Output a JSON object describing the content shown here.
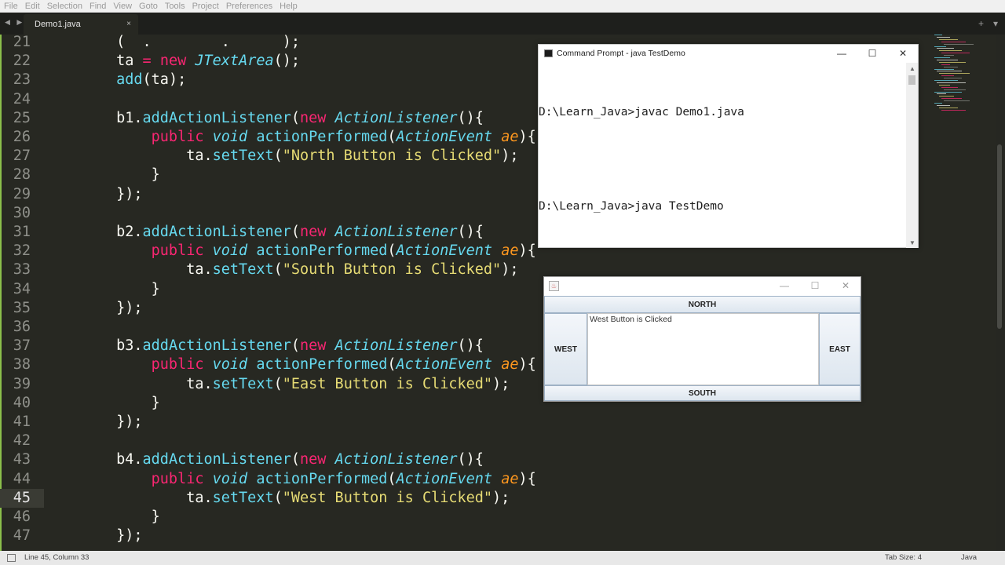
{
  "menu": [
    "File",
    "Edit",
    "Selection",
    "Find",
    "View",
    "Goto",
    "Tools",
    "Project",
    "Preferences",
    "Help"
  ],
  "tabs": [
    {
      "label": "Demo1.java",
      "close": "×"
    }
  ],
  "nav_arrows": "◀ ▶",
  "tabbar_right": {
    "add": "+",
    "more": "▾"
  },
  "editor": {
    "current_line": 45,
    "lines": [
      {
        "n": 21,
        "tokens": [
          [
            "t-plain",
            "        (  .        .      );"
          ]
        ]
      },
      {
        "n": 22,
        "tokens": [
          [
            "t-plain",
            "        ta "
          ],
          [
            "t-kw",
            "="
          ],
          [
            "t-plain",
            " "
          ],
          [
            "t-kw",
            "new"
          ],
          [
            "t-plain",
            " "
          ],
          [
            "t-type",
            "JTextArea"
          ],
          [
            "t-plain",
            "();"
          ]
        ]
      },
      {
        "n": 23,
        "tokens": [
          [
            "t-plain",
            "        "
          ],
          [
            "t-fn",
            "add"
          ],
          [
            "t-plain",
            "(ta);"
          ]
        ]
      },
      {
        "n": 24,
        "tokens": []
      },
      {
        "n": 25,
        "tokens": [
          [
            "t-plain",
            "        b1."
          ],
          [
            "t-fn",
            "addActionListener"
          ],
          [
            "t-plain",
            "("
          ],
          [
            "t-kw",
            "new"
          ],
          [
            "t-plain",
            " "
          ],
          [
            "t-type",
            "ActionListener"
          ],
          [
            "t-plain",
            "(){"
          ]
        ]
      },
      {
        "n": 26,
        "tokens": [
          [
            "t-plain",
            "            "
          ],
          [
            "t-kw",
            "public"
          ],
          [
            "t-plain",
            " "
          ],
          [
            "t-type",
            "void"
          ],
          [
            "t-plain",
            " "
          ],
          [
            "t-fn",
            "actionPerformed"
          ],
          [
            "t-plain",
            "("
          ],
          [
            "t-type",
            "ActionEvent"
          ],
          [
            "t-plain",
            " "
          ],
          [
            "t-param",
            "ae"
          ],
          [
            "t-plain",
            "){"
          ]
        ]
      },
      {
        "n": 27,
        "tokens": [
          [
            "t-plain",
            "                ta."
          ],
          [
            "t-fn",
            "setText"
          ],
          [
            "t-plain",
            "("
          ],
          [
            "t-str",
            "\"North Button is Clicked\""
          ],
          [
            "t-plain",
            ");"
          ]
        ]
      },
      {
        "n": 28,
        "tokens": [
          [
            "t-plain",
            "            }"
          ]
        ]
      },
      {
        "n": 29,
        "tokens": [
          [
            "t-plain",
            "        });"
          ]
        ]
      },
      {
        "n": 30,
        "tokens": []
      },
      {
        "n": 31,
        "tokens": [
          [
            "t-plain",
            "        b2."
          ],
          [
            "t-fn",
            "addActionListener"
          ],
          [
            "t-plain",
            "("
          ],
          [
            "t-kw",
            "new"
          ],
          [
            "t-plain",
            " "
          ],
          [
            "t-type",
            "ActionListener"
          ],
          [
            "t-plain",
            "(){"
          ]
        ]
      },
      {
        "n": 32,
        "tokens": [
          [
            "t-plain",
            "            "
          ],
          [
            "t-kw",
            "public"
          ],
          [
            "t-plain",
            " "
          ],
          [
            "t-type",
            "void"
          ],
          [
            "t-plain",
            " "
          ],
          [
            "t-fn",
            "actionPerformed"
          ],
          [
            "t-plain",
            "("
          ],
          [
            "t-type",
            "ActionEvent"
          ],
          [
            "t-plain",
            " "
          ],
          [
            "t-param",
            "ae"
          ],
          [
            "t-plain",
            "){"
          ]
        ]
      },
      {
        "n": 33,
        "tokens": [
          [
            "t-plain",
            "                ta."
          ],
          [
            "t-fn",
            "setText"
          ],
          [
            "t-plain",
            "("
          ],
          [
            "t-str",
            "\"South Button is Clicked\""
          ],
          [
            "t-plain",
            ");"
          ]
        ]
      },
      {
        "n": 34,
        "tokens": [
          [
            "t-plain",
            "            }"
          ]
        ]
      },
      {
        "n": 35,
        "tokens": [
          [
            "t-plain",
            "        });"
          ]
        ]
      },
      {
        "n": 36,
        "tokens": []
      },
      {
        "n": 37,
        "tokens": [
          [
            "t-plain",
            "        b3."
          ],
          [
            "t-fn",
            "addActionListener"
          ],
          [
            "t-plain",
            "("
          ],
          [
            "t-kw",
            "new"
          ],
          [
            "t-plain",
            " "
          ],
          [
            "t-type",
            "ActionListener"
          ],
          [
            "t-plain",
            "(){"
          ]
        ]
      },
      {
        "n": 38,
        "tokens": [
          [
            "t-plain",
            "            "
          ],
          [
            "t-kw",
            "public"
          ],
          [
            "t-plain",
            " "
          ],
          [
            "t-type",
            "void"
          ],
          [
            "t-plain",
            " "
          ],
          [
            "t-fn",
            "actionPerformed"
          ],
          [
            "t-plain",
            "("
          ],
          [
            "t-type",
            "ActionEvent"
          ],
          [
            "t-plain",
            " "
          ],
          [
            "t-param",
            "ae"
          ],
          [
            "t-plain",
            "){"
          ]
        ]
      },
      {
        "n": 39,
        "tokens": [
          [
            "t-plain",
            "                ta."
          ],
          [
            "t-fn",
            "setText"
          ],
          [
            "t-plain",
            "("
          ],
          [
            "t-str",
            "\"East Button is Clicked\""
          ],
          [
            "t-plain",
            ");"
          ]
        ]
      },
      {
        "n": 40,
        "tokens": [
          [
            "t-plain",
            "            }"
          ]
        ]
      },
      {
        "n": 41,
        "tokens": [
          [
            "t-plain",
            "        });"
          ]
        ]
      },
      {
        "n": 42,
        "tokens": []
      },
      {
        "n": 43,
        "tokens": [
          [
            "t-plain",
            "        b4."
          ],
          [
            "t-fn",
            "addActionListener"
          ],
          [
            "t-plain",
            "("
          ],
          [
            "t-kw",
            "new"
          ],
          [
            "t-plain",
            " "
          ],
          [
            "t-type",
            "ActionListener"
          ],
          [
            "t-plain",
            "(){"
          ]
        ]
      },
      {
        "n": 44,
        "tokens": [
          [
            "t-plain",
            "            "
          ],
          [
            "t-kw",
            "public"
          ],
          [
            "t-plain",
            " "
          ],
          [
            "t-type",
            "void"
          ],
          [
            "t-plain",
            " "
          ],
          [
            "t-fn",
            "actionPerformed"
          ],
          [
            "t-plain",
            "("
          ],
          [
            "t-type",
            "ActionEvent"
          ],
          [
            "t-plain",
            " "
          ],
          [
            "t-param",
            "ae"
          ],
          [
            "t-plain",
            "){"
          ]
        ]
      },
      {
        "n": 45,
        "tokens": [
          [
            "t-plain",
            "                ta."
          ],
          [
            "t-fn",
            "setText"
          ],
          [
            "t-plain",
            "("
          ],
          [
            "t-str",
            "\"West Button is Clicked\""
          ],
          [
            "t-plain",
            ");"
          ]
        ]
      },
      {
        "n": 46,
        "tokens": [
          [
            "t-plain",
            "            }"
          ]
        ]
      },
      {
        "n": 47,
        "tokens": [
          [
            "t-plain",
            "        });"
          ]
        ]
      }
    ]
  },
  "cmd_window": {
    "title": "Command Prompt - java  TestDemo",
    "lines": [
      "D:\\Learn_Java>javac Demo1.java",
      "",
      "D:\\Learn_Java>java TestDemo"
    ],
    "minimize": "—",
    "maximize": "☐",
    "close": "✕"
  },
  "swing_window": {
    "north": "NORTH",
    "south": "SOUTH",
    "west": "WEST",
    "east": "EAST",
    "textarea_value": "West Button is Clicked",
    "minimize": "—",
    "maximize": "☐",
    "close": "✕"
  },
  "status": {
    "position": "Line 45, Column 33",
    "tab_size": "Tab Size: 4",
    "syntax": "Java"
  },
  "colors": {
    "editor_bg": "#272822",
    "keyword": "#f92672",
    "function": "#66d9ef",
    "string": "#e6db74",
    "param": "#fd971f"
  }
}
